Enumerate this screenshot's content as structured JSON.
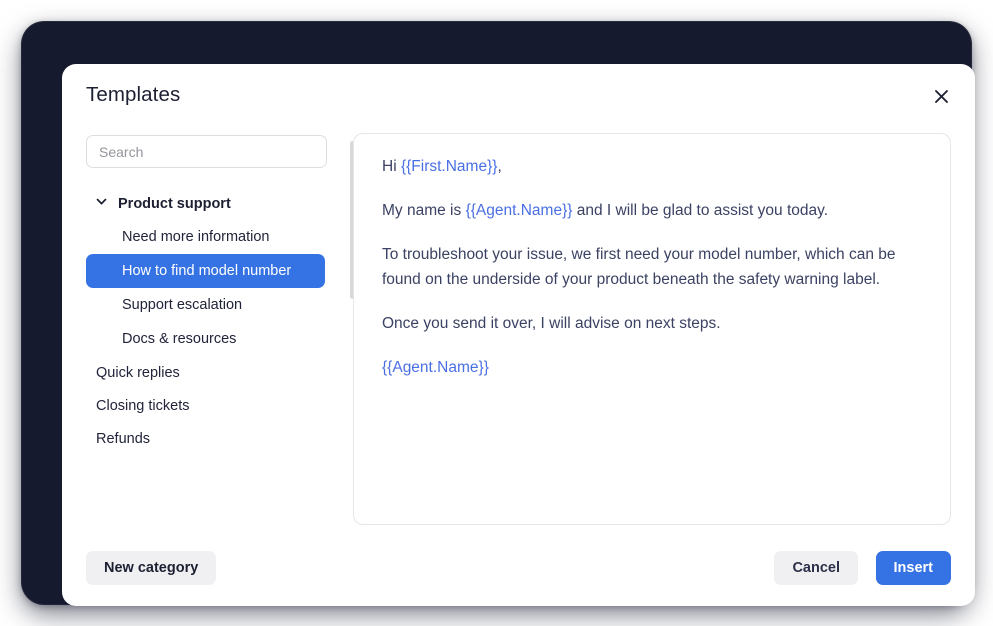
{
  "dialog": {
    "title": "Templates",
    "close_icon": "close-icon"
  },
  "search": {
    "placeholder": "Search",
    "value": ""
  },
  "sidebar": {
    "expanded_category": {
      "label": "Product support",
      "chevron_icon": "chevron-down-icon",
      "expanded": true,
      "templates": [
        {
          "label": "Need more information",
          "selected": false
        },
        {
          "label": "How to find model number",
          "selected": true
        },
        {
          "label": "Support escalation",
          "selected": false
        },
        {
          "label": "Docs & resources",
          "selected": false
        }
      ]
    },
    "categories": [
      {
        "label": "Quick replies"
      },
      {
        "label": "Closing tickets"
      },
      {
        "label": "Refunds"
      }
    ]
  },
  "editor": {
    "paragraphs": [
      [
        {
          "text": "Hi ",
          "token": false
        },
        {
          "text": "{{First.Name}}",
          "token": true
        },
        {
          "text": ",",
          "token": false
        }
      ],
      [
        {
          "text": "My name is ",
          "token": false
        },
        {
          "text": "{{Agent.Name}}",
          "token": true
        },
        {
          "text": " and I will be glad to assist you today.",
          "token": false
        }
      ],
      [
        {
          "text": "To troubleshoot your issue, we first need your model number, which can be found on the underside of your product beneath the safety warning label.",
          "token": false
        }
      ],
      [
        {
          "text": "Once you send it over, I will advise on next steps.",
          "token": false
        }
      ],
      [
        {
          "text": "{{Agent.Name}}",
          "token": true
        }
      ]
    ]
  },
  "footer": {
    "new_category_label": "New category",
    "cancel_label": "Cancel",
    "insert_label": "Insert"
  },
  "colors": {
    "accent_blue": "#3572e3",
    "token_blue": "#4a6fe3",
    "body_text": "#3b4263",
    "frame_dark": "#161a2e",
    "button_grey": "#f0f0f2"
  }
}
